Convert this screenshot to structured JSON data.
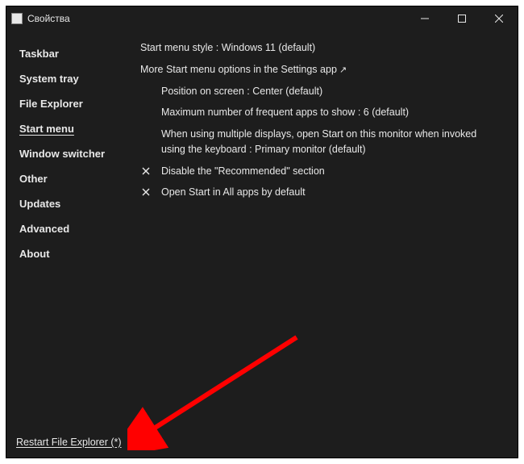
{
  "window": {
    "title": "Свойства"
  },
  "sidebar": {
    "items": [
      {
        "label": "Taskbar"
      },
      {
        "label": "System tray"
      },
      {
        "label": "File Explorer"
      },
      {
        "label": "Start menu"
      },
      {
        "label": "Window switcher"
      },
      {
        "label": "Other"
      },
      {
        "label": "Updates"
      },
      {
        "label": "Advanced"
      },
      {
        "label": "About"
      }
    ],
    "active_index": 3
  },
  "content": {
    "style_row": "Start menu style : Windows 11 (default)",
    "more_options_link": "More Start menu options in the Settings app",
    "position_row": "Position on screen : Center (default)",
    "max_apps_row": "Maximum number of frequent apps to show : 6 (default)",
    "multi_display_row": "When using multiple displays, open Start on this monitor when invoked using the keyboard : Primary monitor (default)",
    "disable_recommended": "Disable the \"Recommended\" section",
    "open_all_apps": "Open Start in All apps by default"
  },
  "footer": {
    "restart_label": "Restart File Explorer (*)"
  },
  "annotation": {
    "arrow_color": "#ff0000"
  }
}
